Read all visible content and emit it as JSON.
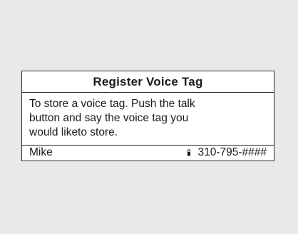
{
  "dialog": {
    "title": "Register Voice Tag",
    "message_lines": [
      "To store a voice tag. Push the talk",
      "button and say the voice tag you",
      "would liketo store."
    ]
  },
  "entry": {
    "name": "Mike",
    "number": "310-795-####",
    "icon": "phone-icon"
  }
}
